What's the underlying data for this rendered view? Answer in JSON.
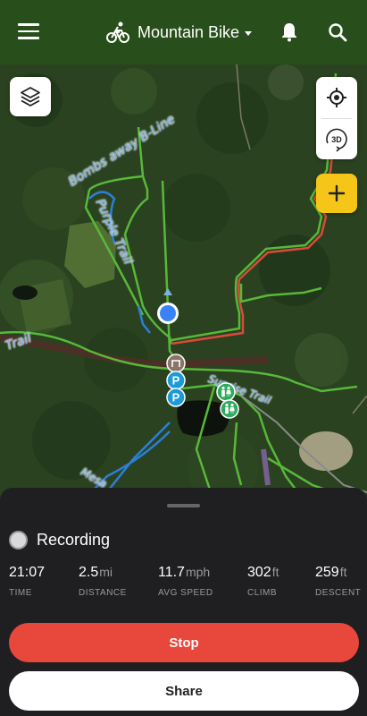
{
  "header": {
    "activity_title": "Mountain Bike",
    "icons": [
      "menu-icon",
      "mountain-bike-icon",
      "dropdown-caret-icon",
      "bell-icon",
      "search-icon"
    ]
  },
  "map": {
    "trail_labels": [
      "Bombs away B-Line",
      "Purple Trail",
      "Trail",
      "Sunrise Trail",
      "Mesa"
    ],
    "controls": [
      "layers-icon",
      "locate-icon",
      "3d-icon",
      "plus-icon"
    ],
    "markers": [
      "gate-icon",
      "parking-icon",
      "parking-icon",
      "restroom-icon",
      "restroom-icon"
    ],
    "three_d_label": "3D"
  },
  "recording": {
    "status_label": "Recording"
  },
  "stats": [
    {
      "value": "21:07",
      "unit": "",
      "label": "TIME"
    },
    {
      "value": "2.5",
      "unit": "mi",
      "label": "DISTANCE"
    },
    {
      "value": "11.7",
      "unit": "mph",
      "label": "AVG SPEED"
    },
    {
      "value": "302",
      "unit": "ft",
      "label": "CLIMB"
    },
    {
      "value": "259",
      "unit": "ft",
      "label": "DESCENT"
    }
  ],
  "actions": {
    "stop_label": "Stop",
    "share_label": "Share"
  },
  "colors": {
    "header_bg": "#284f1b",
    "stop": "#e8473b",
    "add_button": "#f5c518",
    "location_dot": "#3b82f6"
  }
}
